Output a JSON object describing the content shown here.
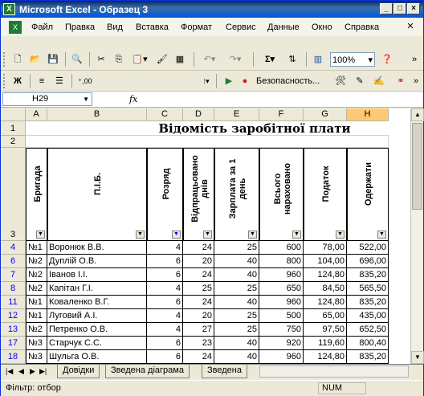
{
  "window": {
    "title": "Microsoft Excel - Образец 3"
  },
  "menu": {
    "items": [
      "Файл",
      "Правка",
      "Вид",
      "Вставка",
      "Формат",
      "Сервис",
      "Данные",
      "Окно",
      "Справка"
    ]
  },
  "toolbar": {
    "zoom": "100%",
    "security": "Безопасность...",
    "bold": "Ж"
  },
  "formula_bar": {
    "name_box": "H29",
    "fx": "fx",
    "value": ""
  },
  "sheet": {
    "title": "Відомість заробітної плати",
    "columns": [
      "A",
      "B",
      "C",
      "D",
      "E",
      "F",
      "G",
      "H"
    ],
    "headers": [
      "Бригада",
      "П.І.Б.",
      "Розряд",
      "Відпрацьовано днів",
      "Зарплата за 1 день",
      "Всього нараховано",
      "Податок",
      "Одержати"
    ],
    "row_numbers": [
      "1",
      "2",
      "3",
      "4",
      "6",
      "7",
      "8",
      "11",
      "12",
      "13",
      "17",
      "18"
    ],
    "rows": [
      [
        "№1",
        "Воронюк В.В.",
        "4",
        "24",
        "25",
        "600",
        "78,00",
        "522,00"
      ],
      [
        "№2",
        "Дуплій О.В.",
        "6",
        "20",
        "40",
        "800",
        "104,00",
        "696,00"
      ],
      [
        "№2",
        "Іванов І.І.",
        "6",
        "24",
        "40",
        "960",
        "124,80",
        "835,20"
      ],
      [
        "№2",
        "Капітан Г.І.",
        "4",
        "25",
        "25",
        "650",
        "84,50",
        "565,50"
      ],
      [
        "№1",
        "Коваленко В.Г.",
        "6",
        "24",
        "40",
        "960",
        "124,80",
        "835,20"
      ],
      [
        "№1",
        "Луговий А.І.",
        "4",
        "20",
        "25",
        "500",
        "65,00",
        "435,00"
      ],
      [
        "№2",
        "Петренко О.В.",
        "4",
        "27",
        "25",
        "750",
        "97,50",
        "652,50"
      ],
      [
        "№3",
        "Старчук С.С.",
        "6",
        "23",
        "40",
        "920",
        "119,60",
        "800,40"
      ],
      [
        "№3",
        "Шульга О.В.",
        "6",
        "24",
        "40",
        "960",
        "124,80",
        "835,20"
      ]
    ]
  },
  "tabs": [
    "Довідки",
    "Зведена діаграма",
    "Зведена"
  ],
  "status": {
    "left": "Фільтр: отбор",
    "num": "NUM"
  }
}
